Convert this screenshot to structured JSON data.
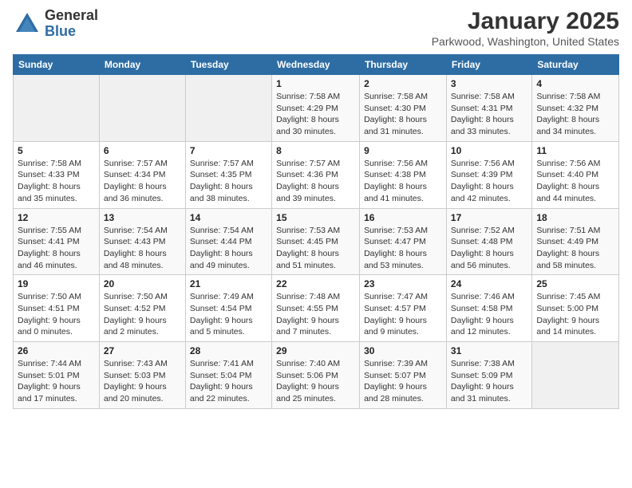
{
  "header": {
    "logo_general": "General",
    "logo_blue": "Blue",
    "main_title": "January 2025",
    "subtitle": "Parkwood, Washington, United States"
  },
  "days_of_week": [
    "Sunday",
    "Monday",
    "Tuesday",
    "Wednesday",
    "Thursday",
    "Friday",
    "Saturday"
  ],
  "weeks": [
    [
      {
        "day": "",
        "info": ""
      },
      {
        "day": "",
        "info": ""
      },
      {
        "day": "",
        "info": ""
      },
      {
        "day": "1",
        "info": "Sunrise: 7:58 AM\nSunset: 4:29 PM\nDaylight: 8 hours\nand 30 minutes."
      },
      {
        "day": "2",
        "info": "Sunrise: 7:58 AM\nSunset: 4:30 PM\nDaylight: 8 hours\nand 31 minutes."
      },
      {
        "day": "3",
        "info": "Sunrise: 7:58 AM\nSunset: 4:31 PM\nDaylight: 8 hours\nand 33 minutes."
      },
      {
        "day": "4",
        "info": "Sunrise: 7:58 AM\nSunset: 4:32 PM\nDaylight: 8 hours\nand 34 minutes."
      }
    ],
    [
      {
        "day": "5",
        "info": "Sunrise: 7:58 AM\nSunset: 4:33 PM\nDaylight: 8 hours\nand 35 minutes."
      },
      {
        "day": "6",
        "info": "Sunrise: 7:57 AM\nSunset: 4:34 PM\nDaylight: 8 hours\nand 36 minutes."
      },
      {
        "day": "7",
        "info": "Sunrise: 7:57 AM\nSunset: 4:35 PM\nDaylight: 8 hours\nand 38 minutes."
      },
      {
        "day": "8",
        "info": "Sunrise: 7:57 AM\nSunset: 4:36 PM\nDaylight: 8 hours\nand 39 minutes."
      },
      {
        "day": "9",
        "info": "Sunrise: 7:56 AM\nSunset: 4:38 PM\nDaylight: 8 hours\nand 41 minutes."
      },
      {
        "day": "10",
        "info": "Sunrise: 7:56 AM\nSunset: 4:39 PM\nDaylight: 8 hours\nand 42 minutes."
      },
      {
        "day": "11",
        "info": "Sunrise: 7:56 AM\nSunset: 4:40 PM\nDaylight: 8 hours\nand 44 minutes."
      }
    ],
    [
      {
        "day": "12",
        "info": "Sunrise: 7:55 AM\nSunset: 4:41 PM\nDaylight: 8 hours\nand 46 minutes."
      },
      {
        "day": "13",
        "info": "Sunrise: 7:54 AM\nSunset: 4:43 PM\nDaylight: 8 hours\nand 48 minutes."
      },
      {
        "day": "14",
        "info": "Sunrise: 7:54 AM\nSunset: 4:44 PM\nDaylight: 8 hours\nand 49 minutes."
      },
      {
        "day": "15",
        "info": "Sunrise: 7:53 AM\nSunset: 4:45 PM\nDaylight: 8 hours\nand 51 minutes."
      },
      {
        "day": "16",
        "info": "Sunrise: 7:53 AM\nSunset: 4:47 PM\nDaylight: 8 hours\nand 53 minutes."
      },
      {
        "day": "17",
        "info": "Sunrise: 7:52 AM\nSunset: 4:48 PM\nDaylight: 8 hours\nand 56 minutes."
      },
      {
        "day": "18",
        "info": "Sunrise: 7:51 AM\nSunset: 4:49 PM\nDaylight: 8 hours\nand 58 minutes."
      }
    ],
    [
      {
        "day": "19",
        "info": "Sunrise: 7:50 AM\nSunset: 4:51 PM\nDaylight: 9 hours\nand 0 minutes."
      },
      {
        "day": "20",
        "info": "Sunrise: 7:50 AM\nSunset: 4:52 PM\nDaylight: 9 hours\nand 2 minutes."
      },
      {
        "day": "21",
        "info": "Sunrise: 7:49 AM\nSunset: 4:54 PM\nDaylight: 9 hours\nand 5 minutes."
      },
      {
        "day": "22",
        "info": "Sunrise: 7:48 AM\nSunset: 4:55 PM\nDaylight: 9 hours\nand 7 minutes."
      },
      {
        "day": "23",
        "info": "Sunrise: 7:47 AM\nSunset: 4:57 PM\nDaylight: 9 hours\nand 9 minutes."
      },
      {
        "day": "24",
        "info": "Sunrise: 7:46 AM\nSunset: 4:58 PM\nDaylight: 9 hours\nand 12 minutes."
      },
      {
        "day": "25",
        "info": "Sunrise: 7:45 AM\nSunset: 5:00 PM\nDaylight: 9 hours\nand 14 minutes."
      }
    ],
    [
      {
        "day": "26",
        "info": "Sunrise: 7:44 AM\nSunset: 5:01 PM\nDaylight: 9 hours\nand 17 minutes."
      },
      {
        "day": "27",
        "info": "Sunrise: 7:43 AM\nSunset: 5:03 PM\nDaylight: 9 hours\nand 20 minutes."
      },
      {
        "day": "28",
        "info": "Sunrise: 7:41 AM\nSunset: 5:04 PM\nDaylight: 9 hours\nand 22 minutes."
      },
      {
        "day": "29",
        "info": "Sunrise: 7:40 AM\nSunset: 5:06 PM\nDaylight: 9 hours\nand 25 minutes."
      },
      {
        "day": "30",
        "info": "Sunrise: 7:39 AM\nSunset: 5:07 PM\nDaylight: 9 hours\nand 28 minutes."
      },
      {
        "day": "31",
        "info": "Sunrise: 7:38 AM\nSunset: 5:09 PM\nDaylight: 9 hours\nand 31 minutes."
      },
      {
        "day": "",
        "info": ""
      }
    ]
  ]
}
